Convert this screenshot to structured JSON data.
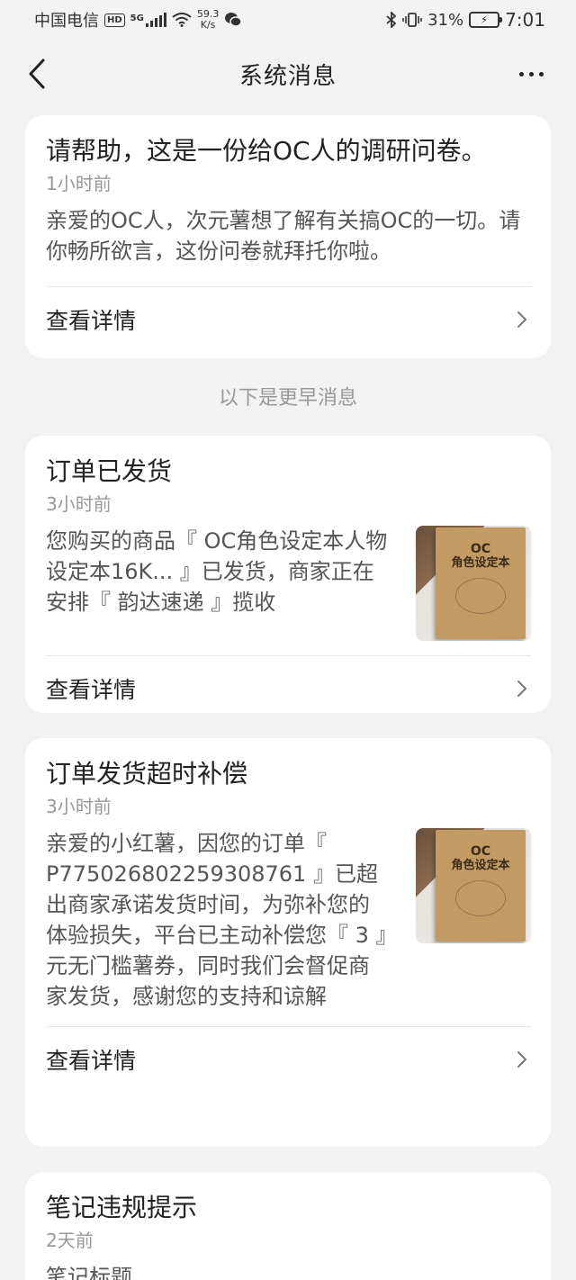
{
  "status_bar": {
    "carrier": "中国电信",
    "hd": "HD",
    "net": "5G",
    "speed_value": "59.3",
    "speed_unit": "K/s",
    "battery": "31%",
    "time": "7:01"
  },
  "nav": {
    "title": "系统消息"
  },
  "earlier_label": "以下是更早消息",
  "messages": [
    {
      "title": "请帮助，这是一份给OC人的调研问卷。",
      "time": "1小时前",
      "text": "亲爱的OC人，次元薯想了解有关搞OC的一切。请你畅所欲言，这份问卷就拜托你啦。",
      "action": "查看详情"
    },
    {
      "title": "订单已发货",
      "time": "3小时前",
      "text": "您购买的商品『 OC角色设定本人物设定本16K... 』已发货，商家正在安排『 韵达速递 』揽收",
      "action": "查看详情",
      "thumb": {
        "line1": "OC",
        "line2": "角色设定本"
      }
    },
    {
      "title": "订单发货超时补偿",
      "time": "3小时前",
      "text": "亲爱的小红薯，因您的订单『 P775026802259308761 』已超出商家承诺发货时间，为弥补您的体验损失，平台已主动补偿您『 3 』元无门槛薯券，同时我们会督促商家发货，感谢您的支持和谅解",
      "action": "查看详情",
      "thumb": {
        "line1": "OC",
        "line2": "角色设定本"
      }
    },
    {
      "title": "笔记违规提示",
      "time": "2天前",
      "text": "笔记标题"
    }
  ],
  "icons": {
    "back": "chevron-left-icon",
    "more": "more-dots-icon",
    "chevron": "chevron-right-icon",
    "wifi": "wifi-icon",
    "signal": "signal-icon",
    "wechat": "wechat-icon",
    "bluetooth": "bluetooth-icon",
    "vibrate": "vibrate-icon",
    "battery": "battery-icon"
  }
}
